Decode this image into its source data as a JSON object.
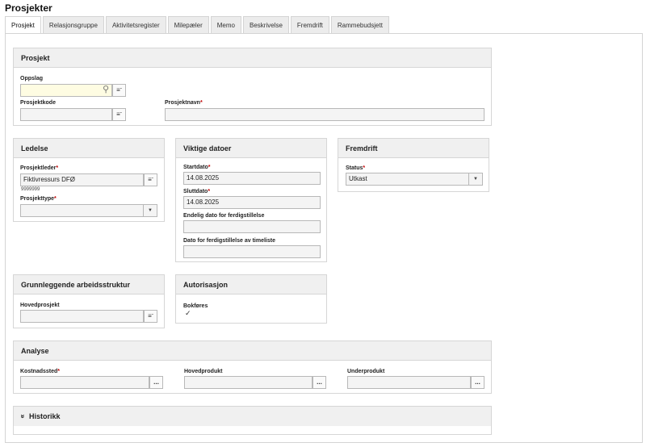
{
  "page_title": "Prosjekter",
  "tabs": [
    "Prosjekt",
    "Relasjonsgruppe",
    "Aktivitetsregister",
    "Milepæler",
    "Memo",
    "Beskrivelse",
    "Fremdrift",
    "Rammebudsjett"
  ],
  "required_mark": "*",
  "prosjekt": {
    "title": "Prosjekt",
    "oppslag_label": "Oppslag",
    "oppslag_value": "",
    "prosjektkode_label": "Prosjektkode",
    "prosjektkode_value": "",
    "prosjektnavn_label": "Prosjektnavn",
    "prosjektnavn_value": ""
  },
  "ledelse": {
    "title": "Ledelse",
    "prosjektleder_label": "Prosjektleder",
    "prosjektleder_value": "Fiktivressurs DFØ",
    "prosjektleder_id": "9999999",
    "prosjekttype_label": "Prosjekttype",
    "prosjekttype_value": ""
  },
  "datoer": {
    "title": "Viktige datoer",
    "startdato_label": "Startdato",
    "startdato_value": "14.08.2025",
    "sluttdato_label": "Sluttdato",
    "sluttdato_value": "14.08.2025",
    "endelig_label": "Endelig dato for ferdigstillelse",
    "endelig_value": "",
    "timeliste_label": "Dato for ferdigstillelse av timeliste",
    "timeliste_value": ""
  },
  "fremdrift": {
    "title": "Fremdrift",
    "status_label": "Status",
    "status_value": "Utkast"
  },
  "arbeidsstruktur": {
    "title": "Grunnleggende arbeidsstruktur",
    "hovedprosjekt_label": "Hovedprosjekt",
    "hovedprosjekt_value": ""
  },
  "autorisasjon": {
    "title": "Autorisasjon",
    "bokfores_label": "Bokføres",
    "bokfores_checked": true
  },
  "analyse": {
    "title": "Analyse",
    "kostnadssted_label": "Kostnadssted",
    "kostnadssted_value": "",
    "hovedprodukt_label": "Hovedprodukt",
    "hovedprodukt_value": "",
    "underprodukt_label": "Underprodukt",
    "underprodukt_value": ""
  },
  "historikk": {
    "title": "Historikk"
  },
  "glyphs": {
    "search": "⚲",
    "list": "≡",
    "list_caret": "ˇ",
    "dropdown": "▼",
    "ellipsis": "...",
    "check": "✓",
    "expand": "»"
  },
  "colors": {
    "required": "#c00000",
    "lookup_field_bg": "#fefce2",
    "panel_header_bg": "#f0f0f0"
  }
}
